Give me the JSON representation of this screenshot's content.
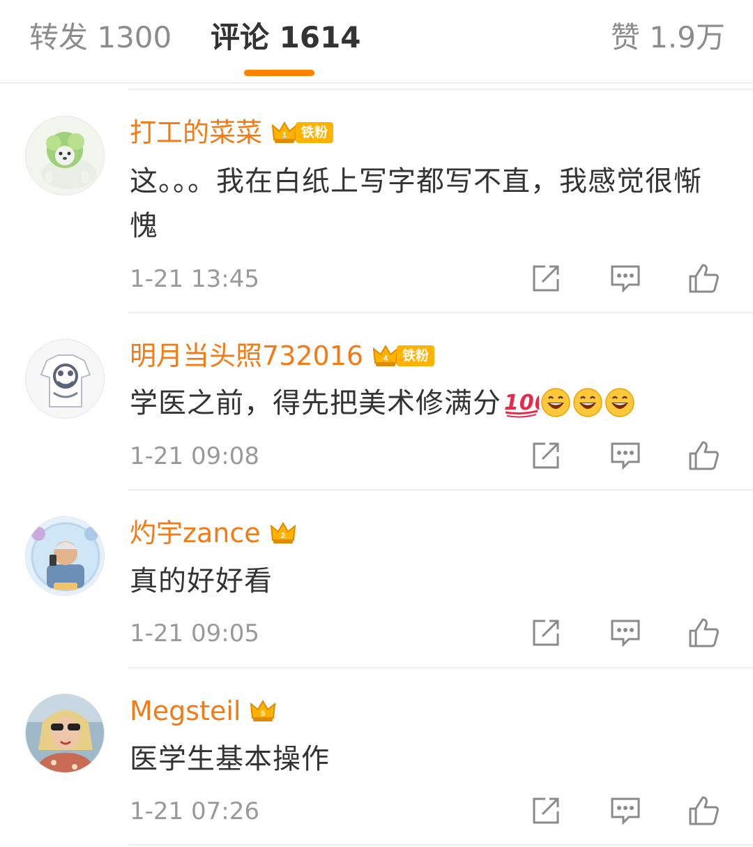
{
  "tabs": {
    "repost": "转发 1300",
    "comments": "评论 1614",
    "likes": "赞 1.9万"
  },
  "colors": {
    "accent": "#ff8200",
    "username": "#f57a14",
    "badge": "#ffb300",
    "text": "#333333",
    "muted": "#999999"
  },
  "comments": [
    {
      "username": "打工的菜菜",
      "badge_level": "1",
      "badge_tag": "铁粉",
      "text": "这。。。我在白纸上写字都写不直，我感觉很惭愧",
      "time": "1-21 13:45"
    },
    {
      "username": "明月当头照732016",
      "badge_level": "4",
      "badge_tag": "铁粉",
      "text": "学医之前，得先把美术修满分",
      "emojis": [
        "hundred-points-icon",
        "laughing-face-icon",
        "laughing-face-icon",
        "laughing-face-icon"
      ],
      "time": "1-21 09:08"
    },
    {
      "username": "灼宇zance",
      "badge_level": "2",
      "text": "真的好好看",
      "time": "1-21 09:05"
    },
    {
      "username": "Megsteil",
      "badge_level": "5",
      "text": "医学生基本操作",
      "time": "1-21 07:26"
    }
  ],
  "actions": [
    "repost-icon",
    "reply-icon",
    "like-icon"
  ]
}
